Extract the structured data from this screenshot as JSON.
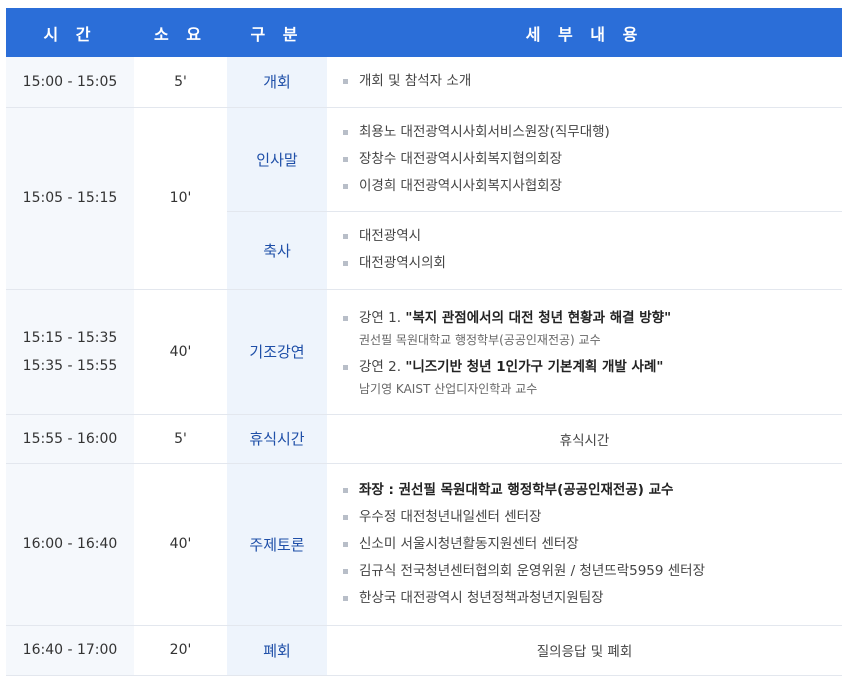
{
  "header": {
    "time": "시 간",
    "duration": "소 요",
    "category": "구 분",
    "details": "세 부 내 용"
  },
  "rows": {
    "r1": {
      "time": "15:00 - 15:05",
      "duration": "5'",
      "category": "개회",
      "items": [
        "개회 및 참석자 소개"
      ]
    },
    "r2": {
      "time": "15:05 - 15:15",
      "duration": "10'",
      "sub1": {
        "category": "인사말",
        "items": [
          "최용노 대전광역시사회서비스원장(직무대행)",
          "장창수 대전광역시사회복지협의회장",
          "이경희 대전광역시사회복지사협회장"
        ]
      },
      "sub2": {
        "category": "축사",
        "items": [
          "대전광역시",
          "대전광역시의회"
        ]
      }
    },
    "r3": {
      "time1": "15:15 - 15:35",
      "time2": "15:35 - 15:55",
      "duration": "40'",
      "category": "기조강연",
      "lec1": {
        "prefix": "강연 1. ",
        "title": "\"복지 관점에서의 대전 청년 현황과 해결 방향\"",
        "speaker": "권선필 목원대학교 행정학부(공공인재전공) 교수"
      },
      "lec2": {
        "prefix": "강연 2. ",
        "title": "\"니즈기반 청년 1인가구 기본계획 개발 사례\"",
        "speaker": "남기영 KAIST 산업디자인학과 교수"
      }
    },
    "r4": {
      "time": "15:55 - 16:00",
      "duration": "5'",
      "category": "휴식시간",
      "detail": "휴식시간"
    },
    "r5": {
      "time": "16:00 - 16:40",
      "duration": "40'",
      "category": "주제토론",
      "items": [
        "좌장 : 권선필 목원대학교 행정학부(공공인재전공) 교수",
        "우수정 대전청년내일센터 센터장",
        "신소미 서울시청년활동지원센터 센터장",
        "김규식 전국청년센터협의회 운영위원 / 청년뜨락5959 센터장",
        "한상국 대전광역시 청년정책과청년지원팀장"
      ]
    },
    "r6": {
      "time": "16:40 - 17:00",
      "duration": "20'",
      "category": "폐회",
      "detail": "질의응답 및 폐회"
    }
  }
}
